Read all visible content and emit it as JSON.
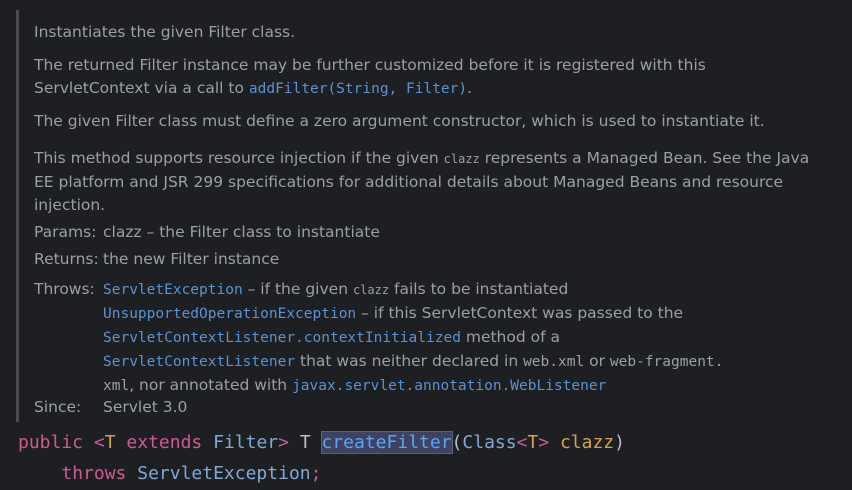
{
  "doc": {
    "p1": "Instantiates the given Filter class.",
    "p2_a": "The returned Filter instance may be further customized before it is registered with this",
    "p2_b": "ServletContext via a call to ",
    "p2_code": "addFilter(String, Filter)",
    "p2_c": ".",
    "p3": "The given Filter class must define a zero argument constructor, which is used to instantiate it.",
    "p4_a": "This method supports resource injection if the given ",
    "p4_code": "clazz",
    "p4_b": " represents a Managed Bean. See the Java",
    "p4_c": "EE platform and JSR 299 specifications for additional details about Managed Beans and resource",
    "p4_d": "injection.",
    "params_label": "Params:",
    "params_value": "clazz – the Filter class to instantiate",
    "returns_label": "Returns:",
    "returns_value": "the new Filter instance",
    "throws_label": "Throws:",
    "throws": {
      "ex1": "ServletException",
      "ex1_text_a": " – if the given ",
      "ex1_code": "clazz",
      "ex1_text_b": " fails to be instantiated",
      "ex2": "UnsupportedOperationException",
      "ex2_text": " – if this ServletContext was passed to the",
      "ex3": "ServletContextListener.contextInitialized",
      "ex3_text": " method of a",
      "ex4": "ServletContextListener",
      "ex4_text_a": " that was neither declared in ",
      "ex4_code1": "web.xml",
      "ex4_text_b": " or ",
      "ex4_code2": "web-fragment.",
      "ex5_code": "xml",
      "ex5_text": ", nor annotated with ",
      "ex5_link": "javax.servlet.annotation.WebListener"
    },
    "since_label": "Since:",
    "since_value": "Servlet 3.0"
  },
  "signature": {
    "kw_public": "public",
    "lt": " <",
    "tparam": "T",
    "kw_extends": " extends ",
    "filter": "Filter",
    "gt": ">",
    "ret": " T ",
    "method": "createFilter",
    "open": "(",
    "class_type": "Class",
    "lt2": "<",
    "tparam2": "T",
    "gt2": ">",
    "arg": " clazz",
    "close": ")",
    "indent": "    ",
    "kw_throws": "throws",
    "exc": " ServletException",
    "semi": ";"
  },
  "colors": {
    "background": "#1e1f22",
    "doc_text": "#9b9fa6",
    "link": "#5a92d4",
    "keyword": "#cf5a93",
    "type_param": "#d4a44c",
    "method_highlight_bg": "#3f4261"
  }
}
